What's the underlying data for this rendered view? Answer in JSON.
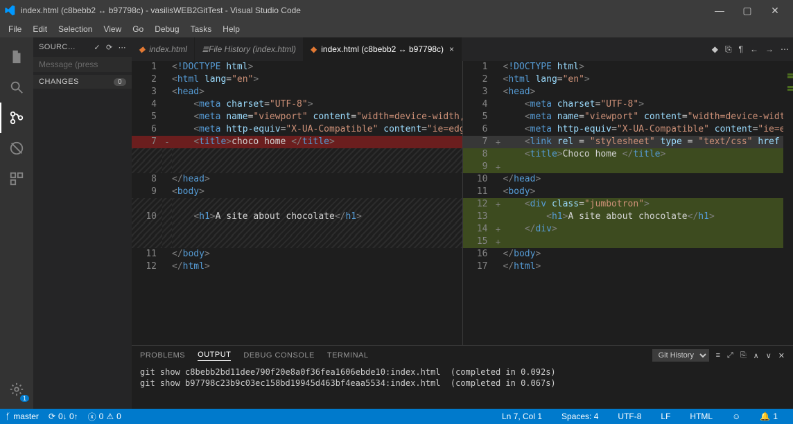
{
  "titlebar": {
    "title": "index.html (c8bebb2 ↔ b97798c) - vasilisWEB2GitTest - Visual Studio Code"
  },
  "menubar": [
    "File",
    "Edit",
    "Selection",
    "View",
    "Go",
    "Debug",
    "Tasks",
    "Help"
  ],
  "sidebar": {
    "header_label": "SOURC…",
    "message_placeholder": "Message (press",
    "section_label": "CHANGES",
    "section_count": "0"
  },
  "activity_badge": "1",
  "tabs": [
    {
      "label": "index.html",
      "active": false
    },
    {
      "label": "File History (index.html)",
      "active": false,
      "icon": "history"
    },
    {
      "label": "index.html (c8bebb2 ↔ b97798c)",
      "active": true
    }
  ],
  "left_pane": [
    {
      "ln": "1",
      "mk": "",
      "cls": "",
      "html": "<span class='tok-punct'>&lt;</span><span class='tok-tag'>!DOCTYPE</span> <span class='tok-attr'>html</span><span class='tok-punct'>&gt;</span>"
    },
    {
      "ln": "2",
      "mk": "",
      "cls": "",
      "html": "<span class='tok-punct'>&lt;</span><span class='tok-tag'>html</span> <span class='tok-attr'>lang</span>=<span class='tok-str'>\"en\"</span><span class='tok-punct'>&gt;</span>"
    },
    {
      "ln": "3",
      "mk": "",
      "cls": "",
      "html": "<span class='tok-punct'>&lt;</span><span class='tok-tag'>head</span><span class='tok-punct'>&gt;</span>"
    },
    {
      "ln": "4",
      "mk": "",
      "cls": "",
      "html": "    <span class='tok-punct'>&lt;</span><span class='tok-tag'>meta</span> <span class='tok-attr'>charset</span>=<span class='tok-str'>\"UTF-8\"</span><span class='tok-punct'>&gt;</span>"
    },
    {
      "ln": "5",
      "mk": "",
      "cls": "",
      "html": "    <span class='tok-punct'>&lt;</span><span class='tok-tag'>meta</span> <span class='tok-attr'>name</span>=<span class='tok-str'>\"viewport\"</span> <span class='tok-attr'>content</span>=<span class='tok-str'>\"width=device-width, initial-sc</span>"
    },
    {
      "ln": "6",
      "mk": "",
      "cls": "",
      "html": "    <span class='tok-punct'>&lt;</span><span class='tok-tag'>meta</span> <span class='tok-attr'>http-equiv</span>=<span class='tok-str'>\"X-UA-Compatible\"</span> <span class='tok-attr'>content</span>=<span class='tok-str'>\"ie=edge\"</span><span class='tok-punct'>&gt;</span>"
    },
    {
      "ln": "7",
      "mk": "-",
      "cls": "deleted",
      "html": "    <span class='tok-punct'>&lt;</span><span class='tok-tag'>title</span><span class='tok-punct'>&gt;</span><span class='tok-text'>choco home </span><span class='tok-punct'>&lt;/</span><span class='tok-tag'>title</span><span class='tok-punct'>&gt;</span>"
    },
    {
      "ln": "",
      "mk": "",
      "cls": "hatch",
      "html": " "
    },
    {
      "ln": "",
      "mk": "",
      "cls": "hatch",
      "html": " "
    },
    {
      "ln": "8",
      "mk": "",
      "cls": "",
      "html": "<span class='tok-punct'>&lt;/</span><span class='tok-tag'>head</span><span class='tok-punct'>&gt;</span>"
    },
    {
      "ln": "9",
      "mk": "",
      "cls": "",
      "html": "<span class='tok-punct'>&lt;</span><span class='tok-tag'>body</span><span class='tok-punct'>&gt;</span>"
    },
    {
      "ln": "",
      "mk": "",
      "cls": "hatch",
      "html": " "
    },
    {
      "ln": "10",
      "mk": "",
      "cls": "hatch",
      "html": "    <span class='tok-punct'>&lt;</span><span class='tok-tag'>h1</span><span class='tok-punct'>&gt;</span><span class='tok-text'>A site about chocolate</span><span class='tok-punct'>&lt;/</span><span class='tok-tag'>h1</span><span class='tok-punct'>&gt;</span>"
    },
    {
      "ln": "",
      "mk": "",
      "cls": "hatch",
      "html": " "
    },
    {
      "ln": "",
      "mk": "",
      "cls": "hatch",
      "html": " "
    },
    {
      "ln": "11",
      "mk": "",
      "cls": "",
      "html": "<span class='tok-punct'>&lt;/</span><span class='tok-tag'>body</span><span class='tok-punct'>&gt;</span>"
    },
    {
      "ln": "12",
      "mk": "",
      "cls": "",
      "html": "<span class='tok-punct'>&lt;/</span><span class='tok-tag'>html</span><span class='tok-punct'>&gt;</span>"
    }
  ],
  "right_pane": [
    {
      "ln": "1",
      "mk": "",
      "cls": "",
      "html": "<span class='tok-punct'>&lt;</span><span class='tok-tag'>!DOCTYPE</span> <span class='tok-attr'>html</span><span class='tok-punct'>&gt;</span>"
    },
    {
      "ln": "2",
      "mk": "",
      "cls": "",
      "html": "<span class='tok-punct'>&lt;</span><span class='tok-tag'>html</span> <span class='tok-attr'>lang</span>=<span class='tok-str'>\"en\"</span><span class='tok-punct'>&gt;</span>"
    },
    {
      "ln": "3",
      "mk": "",
      "cls": "",
      "html": "<span class='tok-punct'>&lt;</span><span class='tok-tag'>head</span><span class='tok-punct'>&gt;</span>"
    },
    {
      "ln": "4",
      "mk": "",
      "cls": "",
      "html": "    <span class='tok-punct'>&lt;</span><span class='tok-tag'>meta</span> <span class='tok-attr'>charset</span>=<span class='tok-str'>\"UTF-8\"</span><span class='tok-punct'>&gt;</span>"
    },
    {
      "ln": "5",
      "mk": "",
      "cls": "",
      "html": "    <span class='tok-punct'>&lt;</span><span class='tok-tag'>meta</span> <span class='tok-attr'>name</span>=<span class='tok-str'>\"viewport\"</span> <span class='tok-attr'>content</span>=<span class='tok-str'>\"width=device-width, initial-sc</span>"
    },
    {
      "ln": "6",
      "mk": "",
      "cls": "",
      "html": "    <span class='tok-punct'>&lt;</span><span class='tok-tag'>meta</span> <span class='tok-attr'>http-equiv</span>=<span class='tok-str'>\"X-UA-Compatible\"</span> <span class='tok-attr'>content</span>=<span class='tok-str'>\"ie=edge\"</span><span class='tok-punct'>&gt;</span>"
    },
    {
      "ln": "7",
      "mk": "+",
      "cls": "added current",
      "html": "    <span class='tok-punct'>&lt;</span><span class='tok-tag'>link</span> <span class='tok-attr'>rel</span> = <span class='tok-str'>\"stylesheet\"</span> <span class='tok-attr'>type</span> = <span class='tok-str'>\"text/css\"</span> <span class='tok-attr'>href</span> =<span class='tok-str'>\"css/mystyle</span>"
    },
    {
      "ln": "8",
      "mk": "",
      "cls": "added",
      "html": "    <span class='tok-punct'>&lt;</span><span class='tok-tag'>title</span><span class='tok-punct'>&gt;</span><span class='tok-text'>Choco home </span><span class='tok-punct'>&lt;/</span><span class='tok-tag'>title</span><span class='tok-punct'>&gt;</span>"
    },
    {
      "ln": "9",
      "mk": "+",
      "cls": "added",
      "html": " "
    },
    {
      "ln": "10",
      "mk": "",
      "cls": "",
      "html": "<span class='tok-punct'>&lt;/</span><span class='tok-tag'>head</span><span class='tok-punct'>&gt;</span>"
    },
    {
      "ln": "11",
      "mk": "",
      "cls": "",
      "html": "<span class='tok-punct'>&lt;</span><span class='tok-tag'>body</span><span class='tok-punct'>&gt;</span>"
    },
    {
      "ln": "12",
      "mk": "+",
      "cls": "added",
      "html": "    <span class='tok-punct'>&lt;</span><span class='tok-tag'>div</span> <span class='tok-attr'>class</span>=<span class='tok-str'>\"jumbotron\"</span><span class='tok-punct'>&gt;</span>"
    },
    {
      "ln": "13",
      "mk": "",
      "cls": "added",
      "html": "        <span class='tok-punct'>&lt;</span><span class='tok-tag'>h1</span><span class='tok-punct'>&gt;</span><span class='tok-text'>A site about chocolate</span><span class='tok-punct'>&lt;/</span><span class='tok-tag'>h1</span><span class='tok-punct'>&gt;</span>"
    },
    {
      "ln": "14",
      "mk": "+",
      "cls": "added",
      "html": "    <span class='tok-punct'>&lt;/</span><span class='tok-tag'>div</span><span class='tok-punct'>&gt;</span>"
    },
    {
      "ln": "15",
      "mk": "+",
      "cls": "added",
      "html": " "
    },
    {
      "ln": "16",
      "mk": "",
      "cls": "",
      "html": "<span class='tok-punct'>&lt;/</span><span class='tok-tag'>body</span><span class='tok-punct'>&gt;</span>"
    },
    {
      "ln": "17",
      "mk": "",
      "cls": "",
      "html": "<span class='tok-punct'>&lt;/</span><span class='tok-tag'>html</span><span class='tok-punct'>&gt;</span>"
    }
  ],
  "panel": {
    "tabs": [
      "PROBLEMS",
      "OUTPUT",
      "DEBUG CONSOLE",
      "TERMINAL"
    ],
    "active_tab": "OUTPUT",
    "select": "Git History",
    "output": "git show c8bebb2bd11dee790f20e8a0f36fea1606ebde10:index.html  (completed in 0.092s)\ngit show b97798c23b9c03ec158bd19945d463bf4eaa5534:index.html  (completed in 0.067s)"
  },
  "statusbar": {
    "branch": "master",
    "sync": "0↓ 0↑",
    "errors": "0",
    "warnings": "0",
    "lncol": "Ln 7, Col 1",
    "spaces": "Spaces: 4",
    "encoding": "UTF-8",
    "eol": "LF",
    "lang": "HTML",
    "feedback": "☺",
    "notif": "1"
  }
}
